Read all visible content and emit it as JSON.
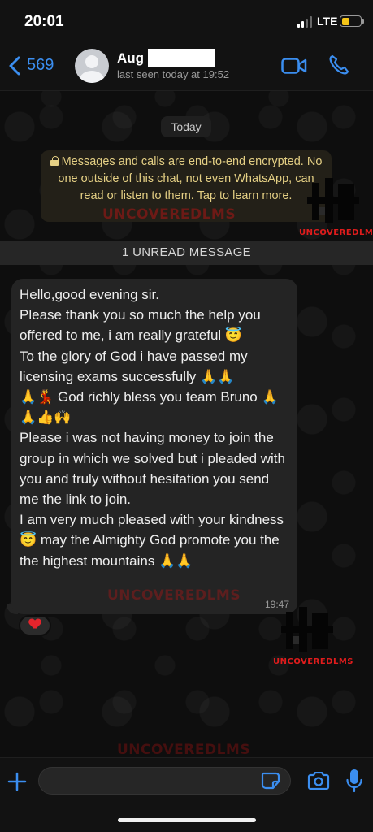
{
  "status_bar": {
    "time": "20:01",
    "network": "LTE"
  },
  "header": {
    "back_count": "569",
    "contact_name": "Aug                 nc",
    "last_seen": "last seen today at 19:52"
  },
  "chat": {
    "date_label": "Today",
    "encryption_notice": "Messages and calls are end-to-end encrypted. No one outside of this chat, not even WhatsApp, can read or listen to them. Tap to learn more.",
    "unread_banner": "1 UNREAD MESSAGE",
    "message": {
      "text": "Hello,good evening sir.\nPlease thank you so much the help you offered to me, i am really grateful 😇\nTo the glory of God i have passed my licensing exams successfully 🙏🙏\n🙏💃 God richly bless you team Bruno 🙏🙏👍🙌\nPlease i was not having money to join the group in which we solved but i pleaded with you and truly without hesitation you send me the link to join.\nI am very much pleased with your kindness 😇 may the Almighty God promote you the the highest mountains 🙏🙏",
      "time": "19:47",
      "reaction": "heart"
    }
  },
  "watermark": {
    "text": "UNCOVEREDLMS",
    "logo_label": "UNCOVEREDLMS",
    "color": "#e01c1c"
  },
  "composer": {
    "placeholder": ""
  },
  "colors": {
    "accent": "#3b8ef0",
    "encryption_text": "#e4cf84",
    "battery": "#f5c518"
  }
}
